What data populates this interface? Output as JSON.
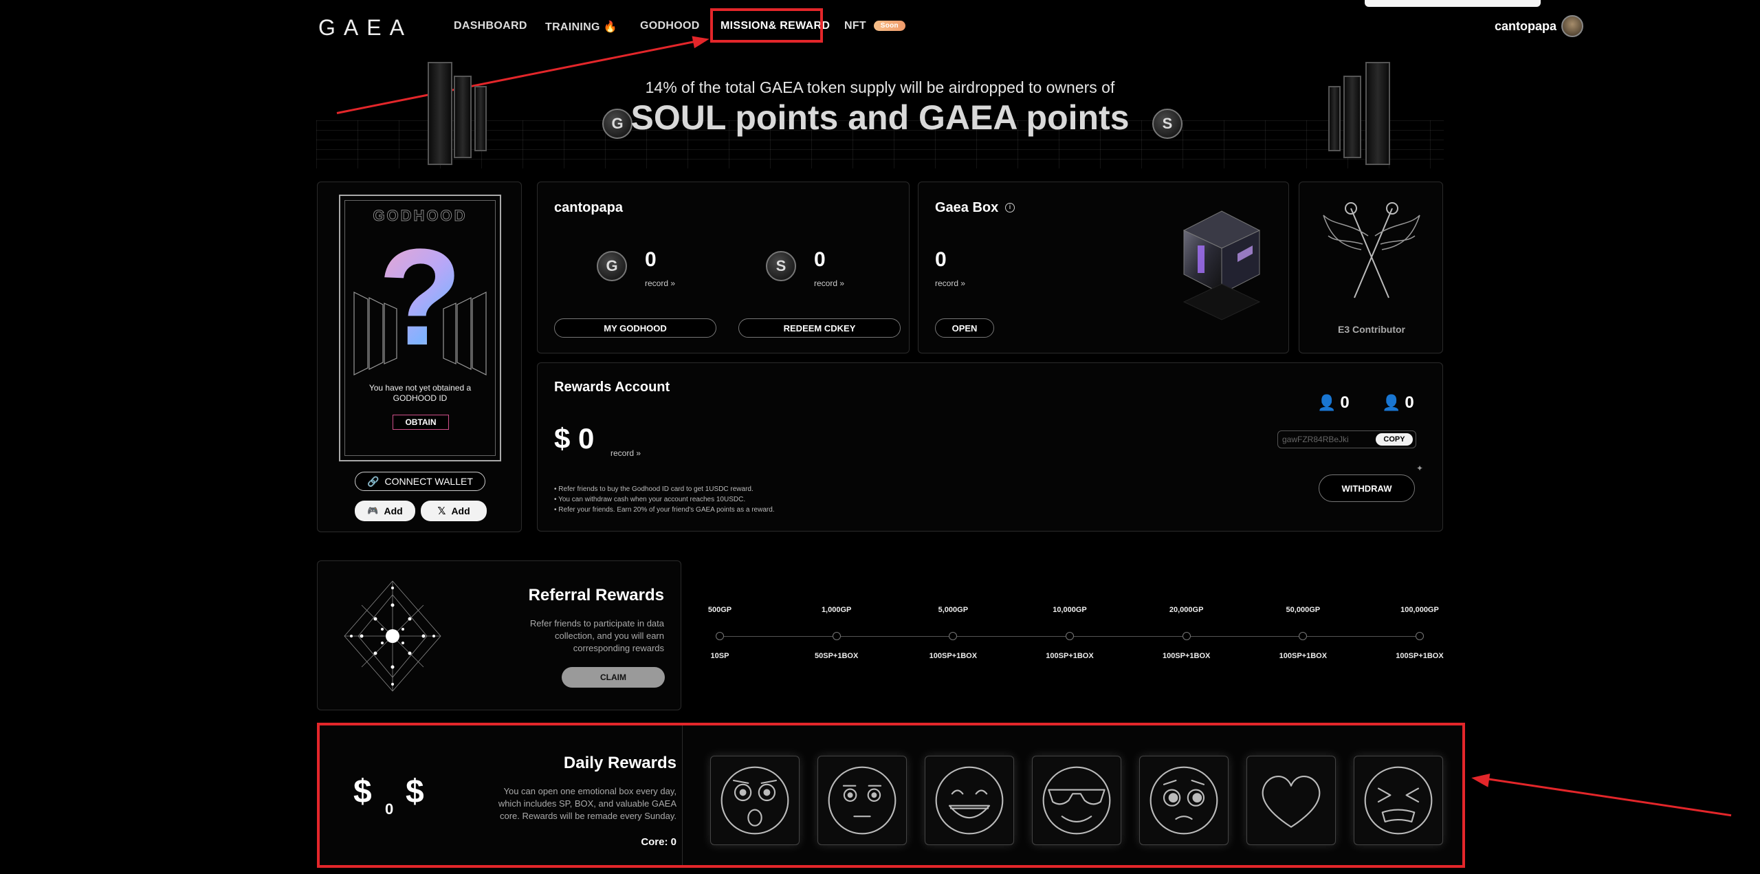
{
  "nav": {
    "logo": "GAEA",
    "items": [
      {
        "label": "DASHBOARD"
      },
      {
        "label": "TRAINING"
      },
      {
        "label": "GODHOOD"
      },
      {
        "label": "MISSION& REWARD"
      },
      {
        "label": "NFT"
      }
    ],
    "nft_badge": "Soon",
    "user_name": "cantopapa"
  },
  "hero": {
    "subtitle": "14% of the total GAEA token supply will be airdropped to owners of",
    "title": "SOUL points and GAEA points"
  },
  "godhood_card": {
    "card_title": "GODHOOD",
    "message": "You have not yet obtained a GODHOOD ID",
    "obtain_label": "OBTAIN",
    "connect_wallet_label": "CONNECT WALLET",
    "discord_add_label": "Add",
    "x_add_label": "Add"
  },
  "profile": {
    "username": "cantopapa",
    "godhood_count": "0",
    "godhood_record": "record",
    "soul_count": "0",
    "soul_record": "record",
    "my_godhood_label": "MY GODHOOD",
    "redeem_label": "REDEEM CDKEY"
  },
  "gaea_box": {
    "title": "Gaea Box",
    "count": "0",
    "record": "record",
    "open_label": "OPEN"
  },
  "contributor": {
    "label": "E3 Contributor"
  },
  "rewards_account": {
    "title": "Rewards Account",
    "currency": "$",
    "amount": "0",
    "record": "record",
    "referral_count_1": "0",
    "referral_count_2": "0",
    "invite_code": "gawFZR84RBeJki",
    "copy_label": "COPY",
    "withdraw_label": "WITHDRAW",
    "notes": [
      "Refer friends to buy the Godhood ID card to get 1USDC reward.",
      "You can withdraw cash when your account reaches 10USDC.",
      "Refer your friends. Earn 20% of your friend's GAEA points as a reward."
    ]
  },
  "referral_rewards": {
    "title": "Referral Rewards",
    "description": "Refer friends to participate in data collection, and you will earn corresponding rewards",
    "claim_label": "CLAIM",
    "milestones": [
      {
        "top": "500GP",
        "bottom": "10SP"
      },
      {
        "top": "1,000GP",
        "bottom": "50SP+1BOX"
      },
      {
        "top": "5,000GP",
        "bottom": "100SP+1BOX"
      },
      {
        "top": "10,000GP",
        "bottom": "100SP+1BOX"
      },
      {
        "top": "20,000GP",
        "bottom": "100SP+1BOX"
      },
      {
        "top": "50,000GP",
        "bottom": "100SP+1BOX"
      },
      {
        "top": "100,000GP",
        "bottom": "100SP+1BOX"
      }
    ]
  },
  "daily_rewards": {
    "title": "Daily Rewards",
    "description": "You can open one emotional box every day, which includes SP, BOX, and valuable GAEA core. Rewards will be remade every Sunday.",
    "core_label": "Core: 0",
    "dollar_left": "$",
    "dollar_count": "0",
    "dollar_right": "$",
    "emojis": [
      "shocked-face-icon",
      "neutral-face-icon",
      "grinning-face-icon",
      "sunglasses-face-icon",
      "pleading-face-icon",
      "heart-icon",
      "squinting-face-icon"
    ]
  },
  "colors": {
    "highlight_red": "#e3262a",
    "background": "#000000"
  }
}
